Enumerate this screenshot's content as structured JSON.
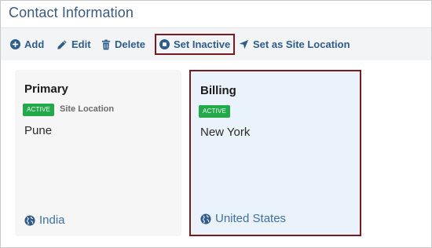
{
  "header": {
    "title": "Contact Information"
  },
  "toolbar": {
    "add_label": "Add",
    "edit_label": "Edit",
    "delete_label": "Delete",
    "set_inactive_label": "Set Inactive",
    "set_site_location_label": "Set as Site Location"
  },
  "cards": [
    {
      "title": "Primary",
      "status": "ACTIVE",
      "tag": "Site Location",
      "city": "Pune",
      "country": "India",
      "selected": false
    },
    {
      "title": "Billing",
      "status": "ACTIVE",
      "tag": "",
      "city": "New York",
      "country": "United States",
      "selected": true
    }
  ],
  "colors": {
    "title": "#3a5a82",
    "toolbar_text": "#2f5c8a",
    "badge_active": "#22a94a",
    "highlight_border": "#7a1a1f",
    "selected_card_bg": "#eaf3fb",
    "card_bg": "#f6f6f6"
  },
  "icons": {
    "add": "plus-circle-icon",
    "edit": "pencil-icon",
    "delete": "trash-icon",
    "set_inactive": "stop-circle-icon",
    "set_site_location": "location-arrow-icon",
    "country": "globe-icon"
  }
}
